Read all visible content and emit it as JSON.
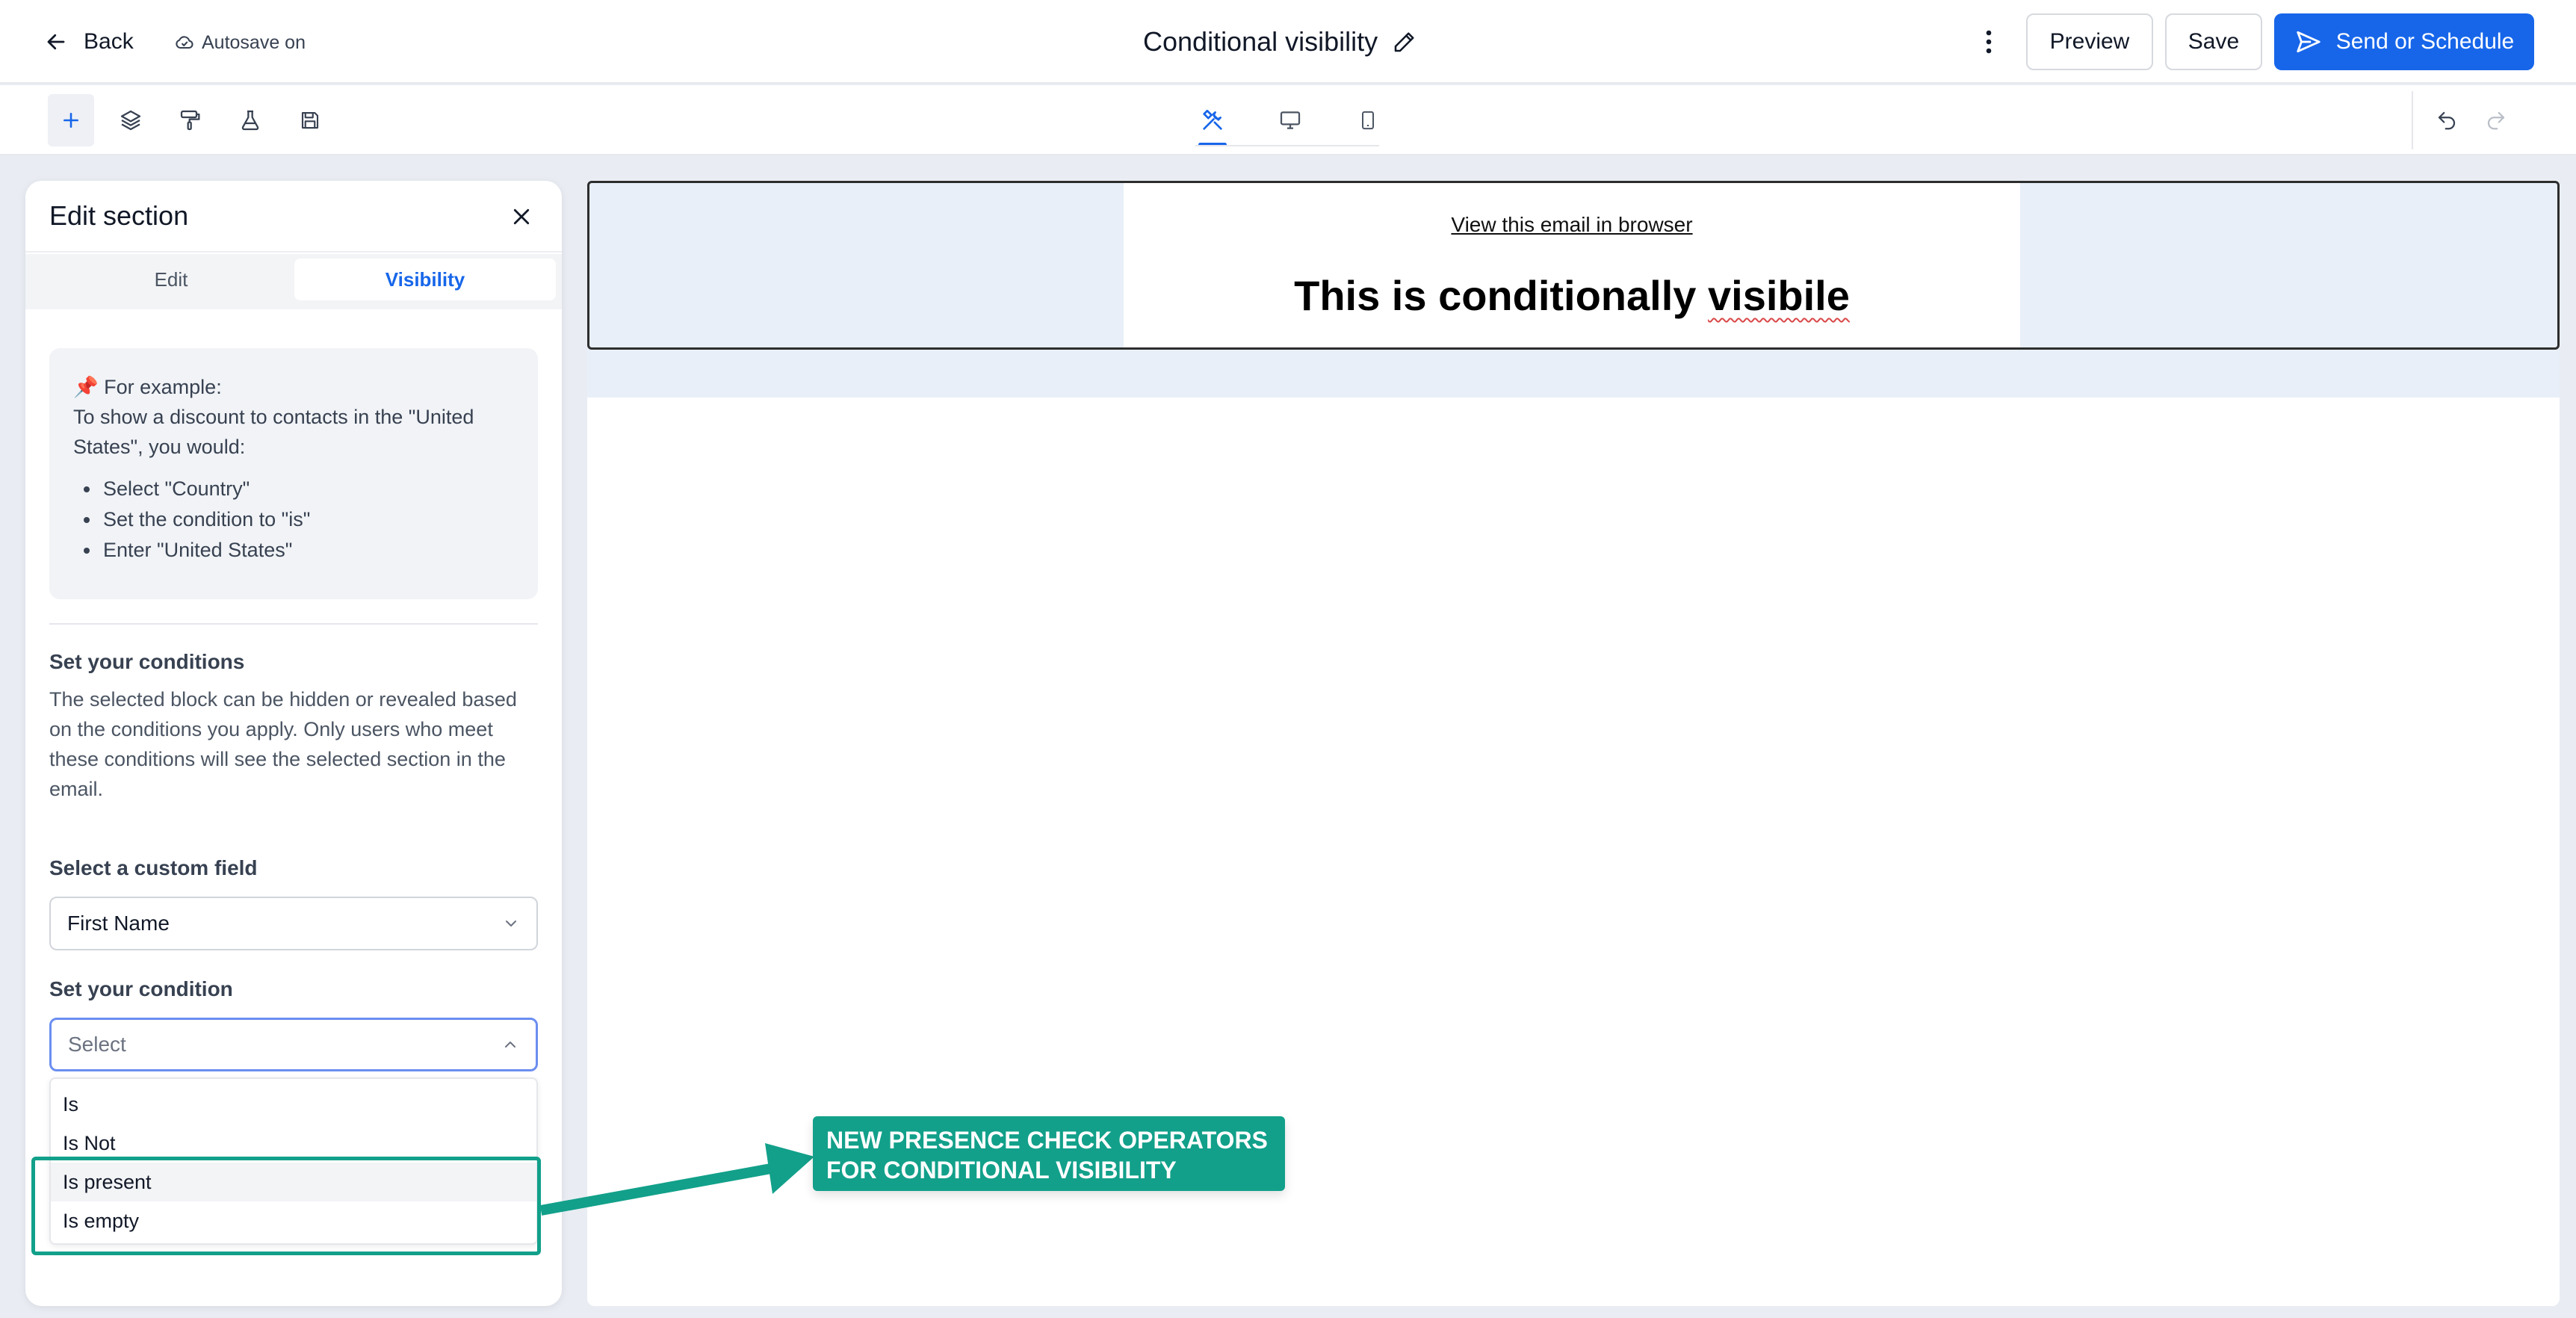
{
  "header": {
    "back_label": "Back",
    "autosave_label": "Autosave on",
    "title": "Conditional visibility",
    "preview_label": "Preview",
    "save_label": "Save",
    "send_label": "Send or Schedule"
  },
  "toolbar": {
    "left_tools": [
      "add-icon",
      "layers-icon",
      "paint-roller-icon",
      "flask-icon",
      "floppy-disk-icon"
    ],
    "view_tabs": [
      "design-tools-icon",
      "desktop-icon",
      "mobile-icon"
    ],
    "right_tools": [
      "undo-icon",
      "redo-icon"
    ]
  },
  "panel": {
    "title": "Edit section",
    "tabs": [
      {
        "label": "Edit",
        "active": false
      },
      {
        "label": "Visibility",
        "active": true
      }
    ],
    "example": {
      "pin": "📌",
      "heading": "For example:",
      "text": "To show a discount to contacts in the \"United States\", you would:",
      "steps": [
        "Select \"Country\"",
        "Set the condition to \"is\"",
        "Enter \"United States\""
      ]
    },
    "conditions_heading": "Set your conditions",
    "conditions_desc": "The selected block can be hidden or revealed based on the conditions you apply. Only users who meet these conditions will see the selected section in the email.",
    "custom_field_label": "Select a custom field",
    "custom_field_value": "First Name",
    "condition_label": "Set your condition",
    "condition_placeholder": "Select",
    "condition_options": [
      "Is",
      "Is Not",
      "Is present",
      "Is empty"
    ],
    "highlighted_option": "Is present"
  },
  "email": {
    "view_in_browser": "View this email in browser",
    "heading_main": "This is conditionally ",
    "heading_misspelled": "visibile"
  },
  "annotation": {
    "line1": "NEW PRESENCE CHECK OPERATORS",
    "line2": "FOR CONDITIONAL VISIBILITY",
    "color": "#12a08a"
  },
  "colors": {
    "accent": "#1766ea",
    "annotation": "#12a08a",
    "canvas_band": "#e8eff8"
  }
}
